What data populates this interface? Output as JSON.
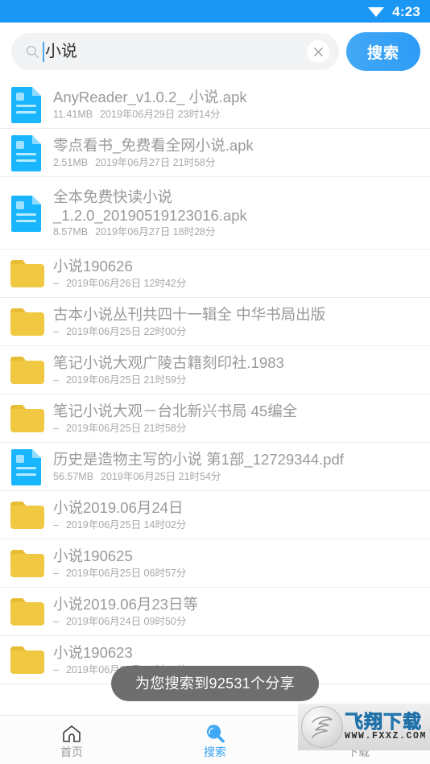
{
  "status_bar": {
    "time": "4:23",
    "wifi_icon": "wifi-icon",
    "background": "#1a96f5"
  },
  "search": {
    "value": "小说",
    "placeholder": "搜索",
    "search_icon": "search-icon",
    "clear_icon": "close-icon",
    "button_label": "搜索",
    "button_color": "#2d9cf7"
  },
  "results": [
    {
      "icon": "file-icon",
      "title": "AnyReader_v1.0.2_ 小说.apk",
      "size": "11.41MB",
      "date": "2019年06月29日 23时14分",
      "rows": 1
    },
    {
      "icon": "file-icon",
      "title": "零点看书_免费看全网小说.apk",
      "size": "2.51MB",
      "date": "2019年06月27日 21时58分",
      "rows": 1
    },
    {
      "icon": "file-icon",
      "title": "全本免费快读小说\n_1.2.0_20190519123016.apk",
      "size": "8.57MB",
      "date": "2019年06月27日 18时28分",
      "rows": 2
    },
    {
      "icon": "folder-icon",
      "title": "小说190626",
      "size": "–",
      "date": "2019年06月26日 12时42分",
      "rows": 1
    },
    {
      "icon": "folder-icon",
      "title": "古本小说丛刊共四十一辑全 中华书局出版",
      "size": "–",
      "date": "2019年06月25日 22时00分",
      "rows": 1
    },
    {
      "icon": "folder-icon",
      "title": "笔记小说大观广陵古籍刻印社.1983",
      "size": "–",
      "date": "2019年06月25日 21时59分",
      "rows": 1
    },
    {
      "icon": "folder-icon",
      "title": "笔记小说大观－台北新兴书局 45编全",
      "size": "–",
      "date": "2019年06月25日 21时58分",
      "rows": 1
    },
    {
      "icon": "file-icon",
      "title": "历史是造物主写的小说 第1部_12729344.pdf",
      "size": "56.57MB",
      "date": "2019年06月25日 21时54分",
      "rows": 1
    },
    {
      "icon": "folder-icon",
      "title": "小说2019.06月24日",
      "size": "–",
      "date": "2019年06月25日 14时02分",
      "rows": 1
    },
    {
      "icon": "folder-icon",
      "title": "小说190625",
      "size": "–",
      "date": "2019年06月25日 06时57分",
      "rows": 1
    },
    {
      "icon": "folder-icon",
      "title": "小说2019.06月23日等",
      "size": "–",
      "date": "2019年06月24日 09时50分",
      "rows": 1
    },
    {
      "icon": "folder-icon",
      "title": "小说190623",
      "size": "–",
      "date": "2019年06月23日 19时40分",
      "rows": 1
    }
  ],
  "toast": {
    "message": "为您搜索到92531个分享"
  },
  "bottom_nav": {
    "items": [
      {
        "label": "首页",
        "icon": "home-icon",
        "active": false
      },
      {
        "label": "搜索",
        "icon": "search-icon",
        "active": true
      },
      {
        "label": "下载",
        "icon": "download-icon",
        "active": false
      }
    ]
  },
  "watermark": {
    "title": "飞翔下载",
    "url": "WWW.FXXZ.COM"
  }
}
